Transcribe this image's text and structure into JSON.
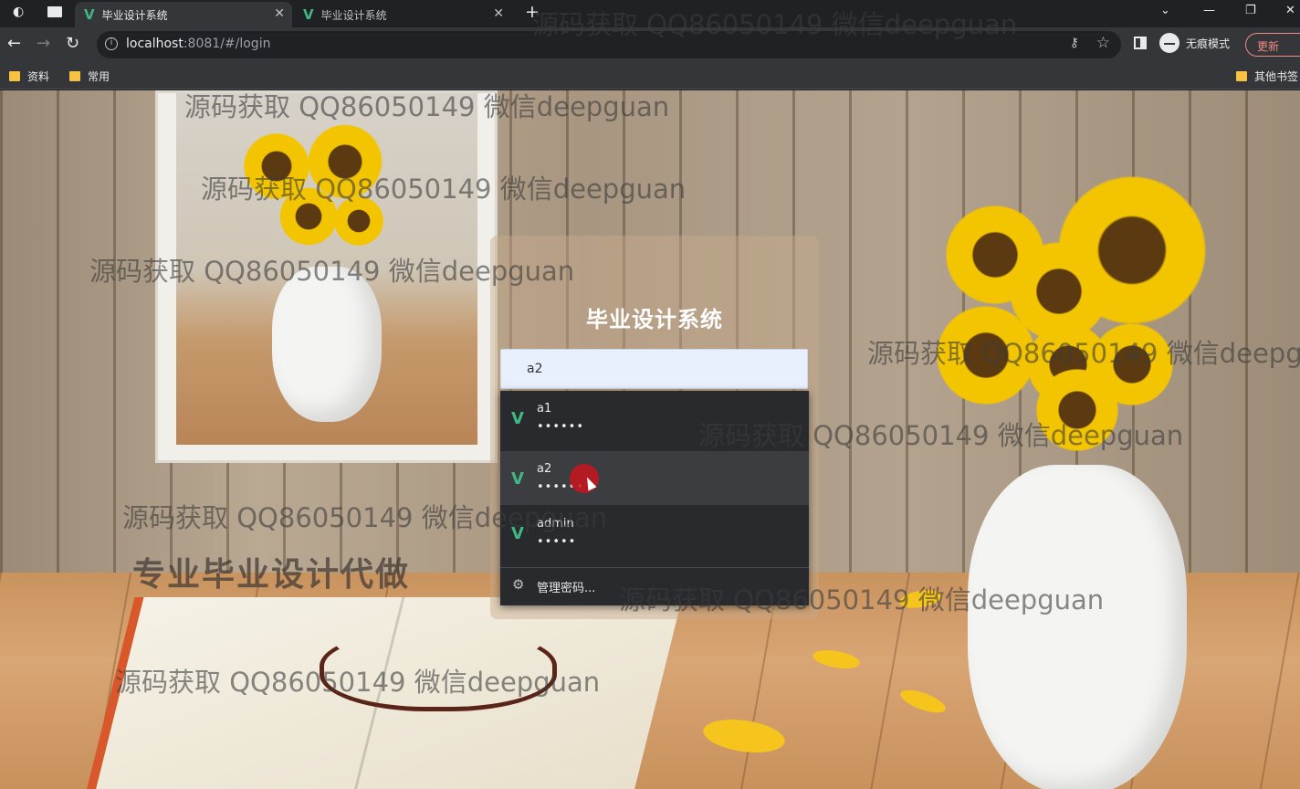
{
  "browser": {
    "tabs": [
      {
        "label": "毕业设计系统",
        "icon": "vue-logo-icon"
      },
      {
        "label": "毕业设计系统",
        "icon": "vue-logo-icon"
      }
    ],
    "new_tab": "+",
    "address": {
      "host": "localhost",
      "rest": ":8081/#/login"
    },
    "incognito_label": "无痕模式",
    "update_label": "更新",
    "bookmarks": [
      "资料",
      "常用"
    ],
    "other_bookmarks": "其他书签"
  },
  "login": {
    "title": "毕业设计系统",
    "username_value": "a2"
  },
  "autofill": {
    "items": [
      {
        "user": "a1",
        "password": "••••••"
      },
      {
        "user": "a2",
        "password": "••••••"
      },
      {
        "user": "admin",
        "password": "•••••"
      }
    ],
    "manage_label": "管理密码..."
  },
  "background_text": "专业毕业设计代做",
  "watermark": "源码获取 QQ86050149 微信deepguan",
  "colors": {
    "vue_green": "#41b883",
    "accent_red": "#f28b82"
  }
}
